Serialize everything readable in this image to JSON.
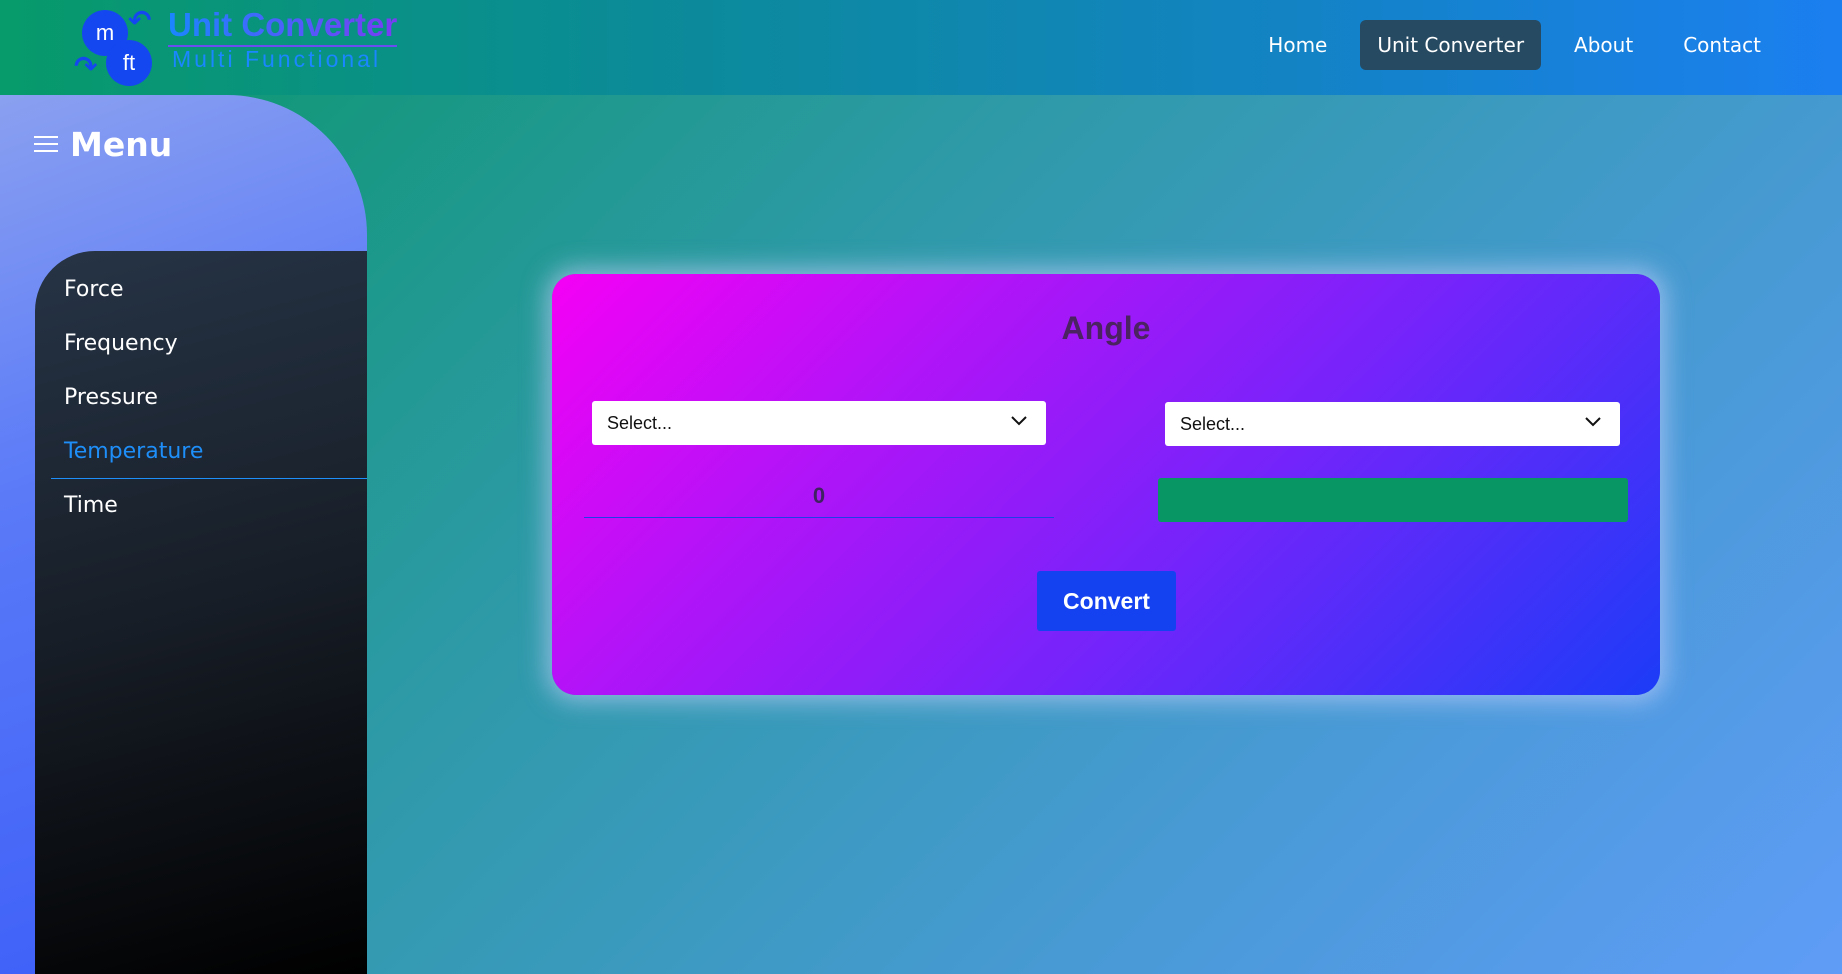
{
  "logo": {
    "circle_top": "m",
    "circle_bottom": "ft",
    "title": "Unit Converter",
    "subtitle": "Multi Functional"
  },
  "nav": {
    "items": [
      {
        "label": "Home",
        "active": false
      },
      {
        "label": "Unit Converter",
        "active": true
      },
      {
        "label": "About",
        "active": false
      },
      {
        "label": "Contact",
        "active": false
      }
    ]
  },
  "sidebar": {
    "title": "Menu",
    "items": [
      {
        "label": "Force",
        "active": false
      },
      {
        "label": "Frequency",
        "active": false
      },
      {
        "label": "Pressure",
        "active": false
      },
      {
        "label": "Temperature",
        "active": true
      },
      {
        "label": "Time",
        "active": false
      }
    ]
  },
  "converter": {
    "title": "Angle",
    "from_select": "Select...",
    "to_select": "Select...",
    "input_value": "0",
    "result_value": "",
    "convert_label": "Convert"
  },
  "colors": {
    "active_nav_bg": "#264a62",
    "active_menu": "#1e8ef8",
    "result_bg": "#089764",
    "button_bg": "#1542f0"
  }
}
